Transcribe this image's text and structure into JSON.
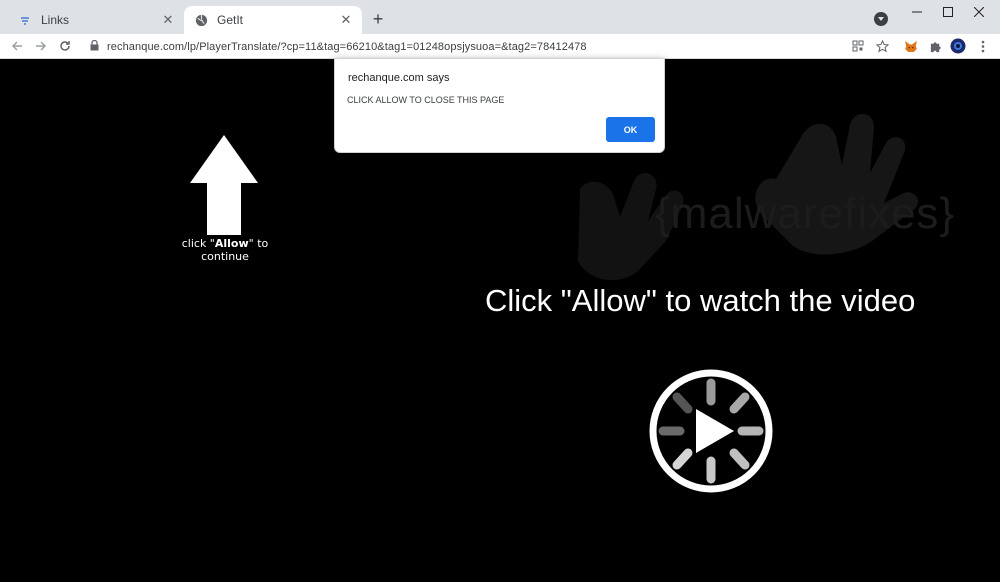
{
  "browser": {
    "tabs": [
      {
        "label": "Links",
        "active": false,
        "icon": "link-favicon"
      },
      {
        "label": "GetIt",
        "active": true,
        "icon": "globe-favicon"
      }
    ],
    "new_tab": "+",
    "address": "rechanque.com/lp/PlayerTranslate/?cp=11&tag=66210&tag1=01248opsjysuoa=&tag2=78412478",
    "window_controls": [
      "minimize",
      "maximize",
      "close"
    ],
    "toolbar_icons": [
      "qr-code-icon",
      "bookmark-star-icon",
      "metamask-fox-icon",
      "extensions-puzzle-icon",
      "profile-avatar-icon",
      "menu-kebab-icon"
    ]
  },
  "page": {
    "arrow_caption_prefix": "click \"",
    "arrow_caption_bold": "Allow",
    "arrow_caption_suffix": "\" to continue",
    "headline": "Click \"Allow\" to watch the video",
    "watermark": "{malwarefixes}"
  },
  "dialog": {
    "origin": "rechanque.com says",
    "message": "CLICK ALLOW TO CLOSE THIS PAGE",
    "ok_label": "OK"
  },
  "colors": {
    "tabstrip": "#dee1e6",
    "page_bg": "#000000",
    "ok_button": "#1a73e8"
  }
}
